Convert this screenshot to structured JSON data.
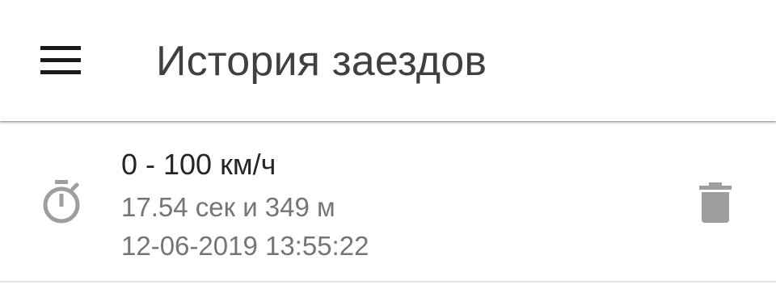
{
  "toolbar": {
    "menu_icon": "hamburger-menu-icon",
    "title": "История заездов"
  },
  "history": {
    "items": [
      {
        "icon": "timer-icon",
        "title": "0 - 100 км/ч",
        "result": "17.54 сек и 349 м",
        "datetime": "12-06-2019 13:55:22",
        "action_icon": "delete-icon"
      }
    ]
  },
  "colors": {
    "title_text": "#404040",
    "primary_text": "#262626",
    "secondary_text": "#757575",
    "icon_gray": "#9e9e9e",
    "divider": "#e6e6e6",
    "background": "#ffffff"
  }
}
